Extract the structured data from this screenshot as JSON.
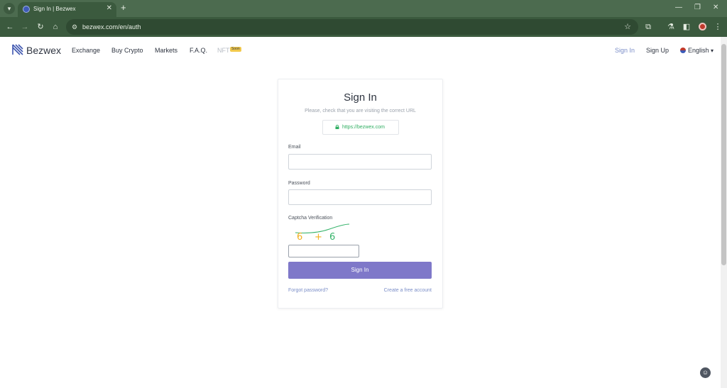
{
  "browser": {
    "tab_list_icon": "chevron-down-icon",
    "tab_title": "Sign In | Bezwex",
    "tab_close": "✕",
    "new_tab": "+",
    "url": "bezwex.com/en/auth",
    "window_controls": [
      "—",
      "❐",
      "✕"
    ]
  },
  "header": {
    "brand": "Bezwex",
    "nav": [
      "Exchange",
      "Buy Crypto",
      "Markets",
      "F.A.Q.",
      "NFT"
    ],
    "nft_badge": "Soon",
    "sign_in": "Sign In",
    "sign_up": "Sign Up",
    "language": "English"
  },
  "form": {
    "title": "Sign In",
    "subtitle": "Please, check that you are visiting the correct URL",
    "secure_url": "https://bezwex.com",
    "email_label": "Email",
    "email_value": "",
    "password_label": "Password",
    "password_value": "",
    "captcha_label": "Captcha Verification",
    "captcha_glyphs": [
      "6",
      "+",
      "6"
    ],
    "captcha_value": "",
    "submit": "Sign In",
    "forgot": "Forgot password?",
    "create": "Create a free account"
  },
  "colors": {
    "chrome": "#3b5a3e",
    "accent": "#7f78c9",
    "link": "#7b8ec8",
    "secure": "#2fae62",
    "badge": "#f2c94c"
  }
}
